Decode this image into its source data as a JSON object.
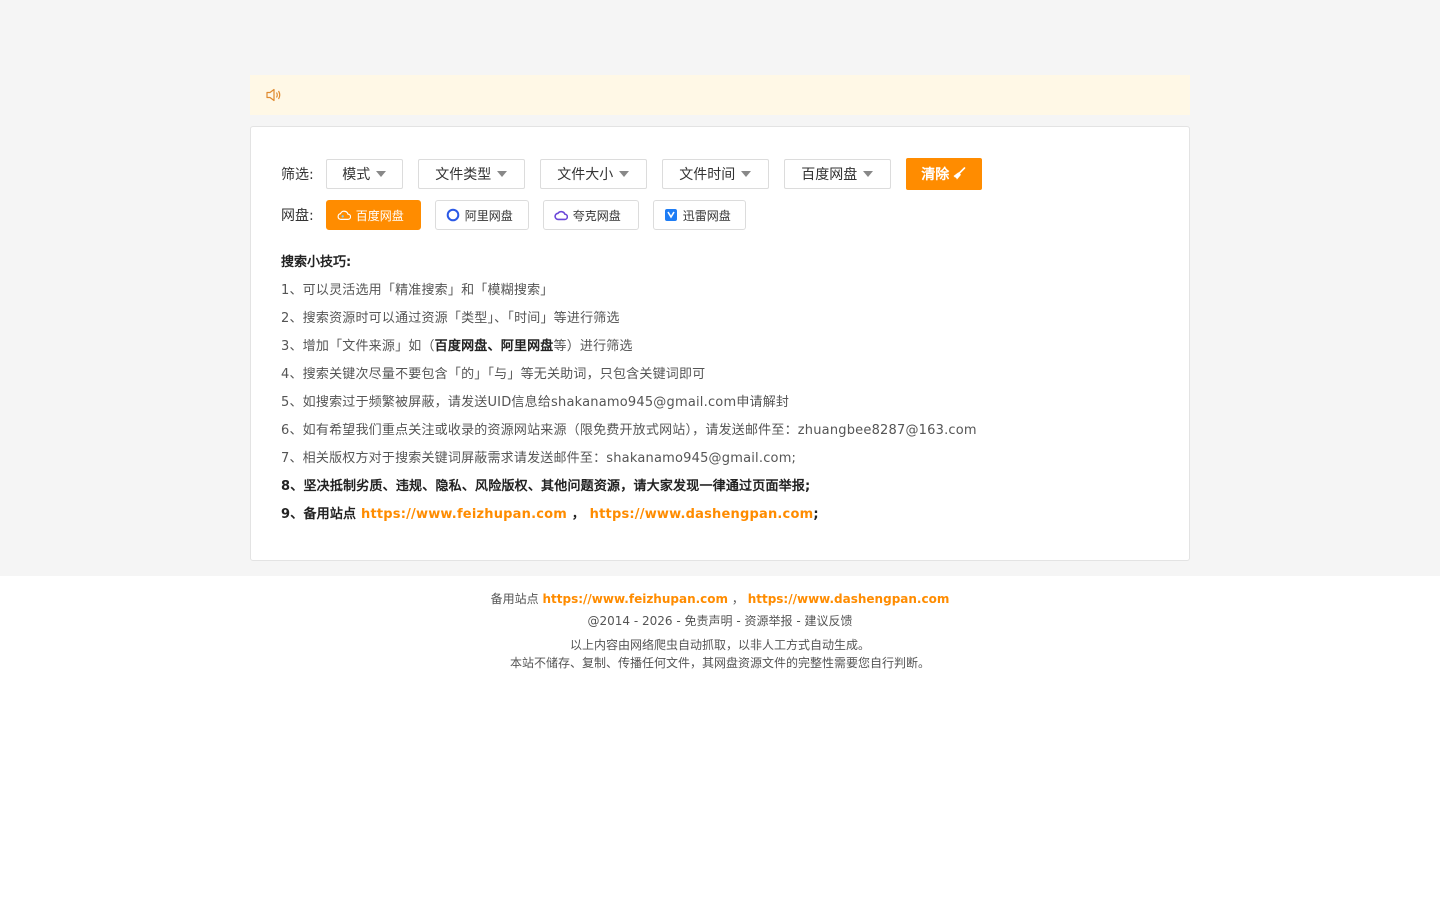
{
  "filters": {
    "label": "筛选:",
    "dropdowns": [
      "模式",
      "文件类型",
      "文件大小",
      "文件时间",
      "百度网盘"
    ],
    "clear_label": "清除"
  },
  "disks": {
    "label": "网盘:",
    "items": [
      {
        "label": "百度网盘",
        "icon": "baidu-cloud-icon",
        "active": true
      },
      {
        "label": "阿里网盘",
        "icon": "aliyun-drive-icon",
        "active": false
      },
      {
        "label": "夸克网盘",
        "icon": "quark-drive-icon",
        "active": false
      },
      {
        "label": "迅雷网盘",
        "icon": "xunlei-drive-icon",
        "active": false
      }
    ]
  },
  "tips": {
    "title": "搜索小技巧:",
    "t1": "1、可以灵活选用「精准搜索」和「模糊搜索」",
    "t2": "2、搜索资源时可以通过资源「类型」、「时间」等进行筛选",
    "t3_pre": "3、增加「文件来源」如（",
    "t3_b1": "百度网盘",
    "t3_sep": "、",
    "t3_b2": "阿里网盘",
    "t3_post": "等）进行筛选",
    "t4": "4、搜索关键次尽量不要包含「的」「与」等无关助词，只包含关键词即可",
    "t5": "5、如搜索过于频繁被屏蔽，请发送UID信息给shakanamo945@gmail.com申请解封",
    "t6": "6、如有希望我们重点关注或收录的资源网站来源（限免费开放式网站），请发送邮件至：zhuangbee8287@163.com",
    "t7": "7、相关版权方对于搜索关键词屏蔽需求请发送邮件至：shakanamo945@gmail.com;",
    "t8": "8、坚决抵制劣质、违规、隐私、风险版权、其他问题资源，请大家发现一律通过页面举报;",
    "t9_pre": "9、备用站点 ",
    "t9_link1": "https://www.feizhupan.com",
    "t9_mid": " ， ",
    "t9_link2": "https://www.dashengpan.com",
    "t9_post": ";"
  },
  "footer": {
    "backup_label": "备用站点 ",
    "link1": "https://www.feizhupan.com",
    "sep": " ， ",
    "link2": "https://www.dashengpan.com",
    "copyright": "@2014 - 2026 - ",
    "disclaimer": "免责声明",
    "dash1": " - ",
    "report": "资源举报",
    "dash2": " - ",
    "feedback": "建议反馈",
    "note1": "以上内容由网络爬虫自动抓取，以非人工方式自动生成。",
    "note2": "本站不储存、复制、传播任何文件，其网盘资源文件的完整性需要您自行判断。"
  },
  "colors": {
    "accent": "#ff8c00",
    "notice_bg": "#fff8e6"
  }
}
